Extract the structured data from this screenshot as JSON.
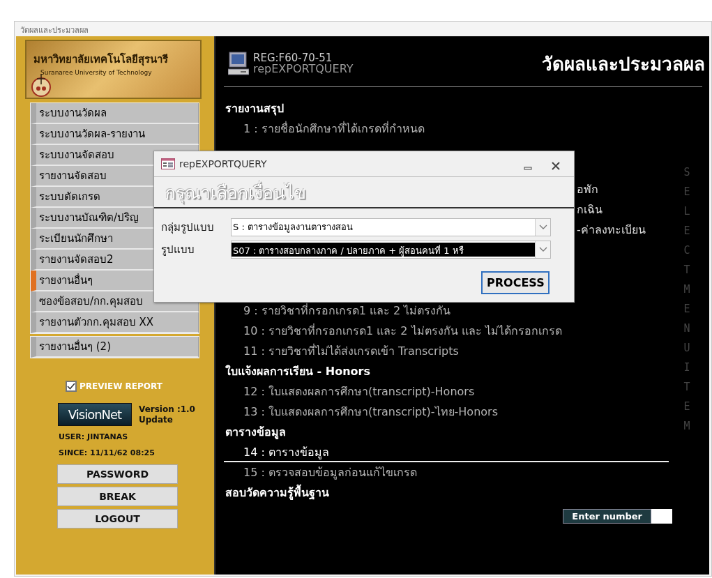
{
  "window": {
    "title": "วัดผลและประมวลผล"
  },
  "sidebar": {
    "logo": {
      "thai_name": "มหาวิทยาลัยเทคโนโลยีสุรนารี",
      "english_name": "Suranaree University of Technology"
    },
    "menu": [
      {
        "label": "ระบบงานวัดผล",
        "selected": false
      },
      {
        "label": "ระบบงานวัดผล-รายงาน",
        "selected": false
      },
      {
        "label": "ระบบงานจัดสอบ",
        "selected": false
      },
      {
        "label": "รายงานจัดสอบ",
        "selected": false
      },
      {
        "label": "ระบบตัดเกรด",
        "selected": false
      },
      {
        "label": "ระบบงานบัณฑิต/ปริญ",
        "selected": false
      },
      {
        "label": "ระเบียนนักศึกษา",
        "selected": false
      },
      {
        "label": "รายงานจัดสอบ2",
        "selected": false
      },
      {
        "label": "รายงานอื่นๆ",
        "selected": true
      },
      {
        "label": "ซองข้อสอบ/กก.คุมสอบ",
        "selected": false
      },
      {
        "label": "รายงานตัวกก.คุมสอบ XX",
        "selected": false
      }
    ],
    "menu_2": [
      {
        "label": "รายงานอื่นๆ (2)",
        "selected": false
      }
    ],
    "preview_report": {
      "label": "PREVIEW REPORT",
      "checked": true
    },
    "brand": {
      "name": "VisionNet",
      "version": "Version :1.0",
      "update": "Update"
    },
    "user": "USER: JINTANAS",
    "since": "SINCE: 11/11/62 08:25",
    "buttons": [
      "PASSWORD",
      "BREAK",
      "LOGOUT"
    ]
  },
  "content": {
    "reg": "REG:F60-70-51",
    "form_name": "repEXPORTQUERY",
    "title": "วัดผลและประมวลผล",
    "menu": [
      {
        "kind": "section",
        "label": "รายงานสรุป"
      },
      {
        "kind": "item",
        "label": "1 : รายชื่อนักศึกษาที่ได้เกรดที่กำหนด",
        "selected": false
      },
      {
        "kind": "tail",
        "label": "อพัก"
      },
      {
        "kind": "tail",
        "label": "กเฉิน"
      },
      {
        "kind": "tail",
        "label": "-ค่าลงทะเบียน"
      },
      {
        "kind": "item",
        "label": "9 : รายวิชาที่กรอกเกรด1 และ 2 ไม่ตรงกัน",
        "selected": false
      },
      {
        "kind": "item",
        "label": "10 : รายวิชาที่กรอกเกรด1 และ 2 ไม่ตรงกัน และ ไม่ได้กรอกเกรด",
        "selected": false
      },
      {
        "kind": "item",
        "label": "11 : รายวิชาที่ไม่ได้ส่งเกรดเข้า Transcripts",
        "selected": false
      },
      {
        "kind": "section",
        "label": "ใบแจ้งผลการเรียน - Honors"
      },
      {
        "kind": "item",
        "label": "12 : ใบแสดงผลการศึกษา(transcript)-Honors",
        "selected": false
      },
      {
        "kind": "item",
        "label": "13 : ใบแสดงผลการศึกษา(transcript)-ไทย-Honors",
        "selected": false
      },
      {
        "kind": "section",
        "label": "ตารางข้อมูล"
      },
      {
        "kind": "item",
        "label": "14 : ตารางข้อมูล",
        "selected": true
      },
      {
        "kind": "item",
        "label": "15 : ตรวจสอบข้อมูลก่อนแก้ไขเกรด",
        "selected": false
      },
      {
        "kind": "section",
        "label": "สอบวัดความรู้พื้นฐาน"
      }
    ],
    "side_caption": "SELECT MENU ITEM",
    "enter_number": {
      "label": "Enter number"
    }
  },
  "dialog": {
    "title": "repEXPORTQUERY",
    "heading": "กรุณาเลือกเงื่อนไข",
    "fields": [
      {
        "label": "กลุ่มรูปแบบ",
        "value": "S : ตารางข้อมูลงานตารางสอน",
        "highlighted": false
      },
      {
        "label": "รูปแบบ",
        "value": "S07 : ตารางสอบกลางภาค / ปลายภาค + ผู้สอนคนที่ 1 หรื",
        "highlighted": true
      }
    ],
    "button": {
      "label": "PROCESS",
      "focused": true
    }
  }
}
